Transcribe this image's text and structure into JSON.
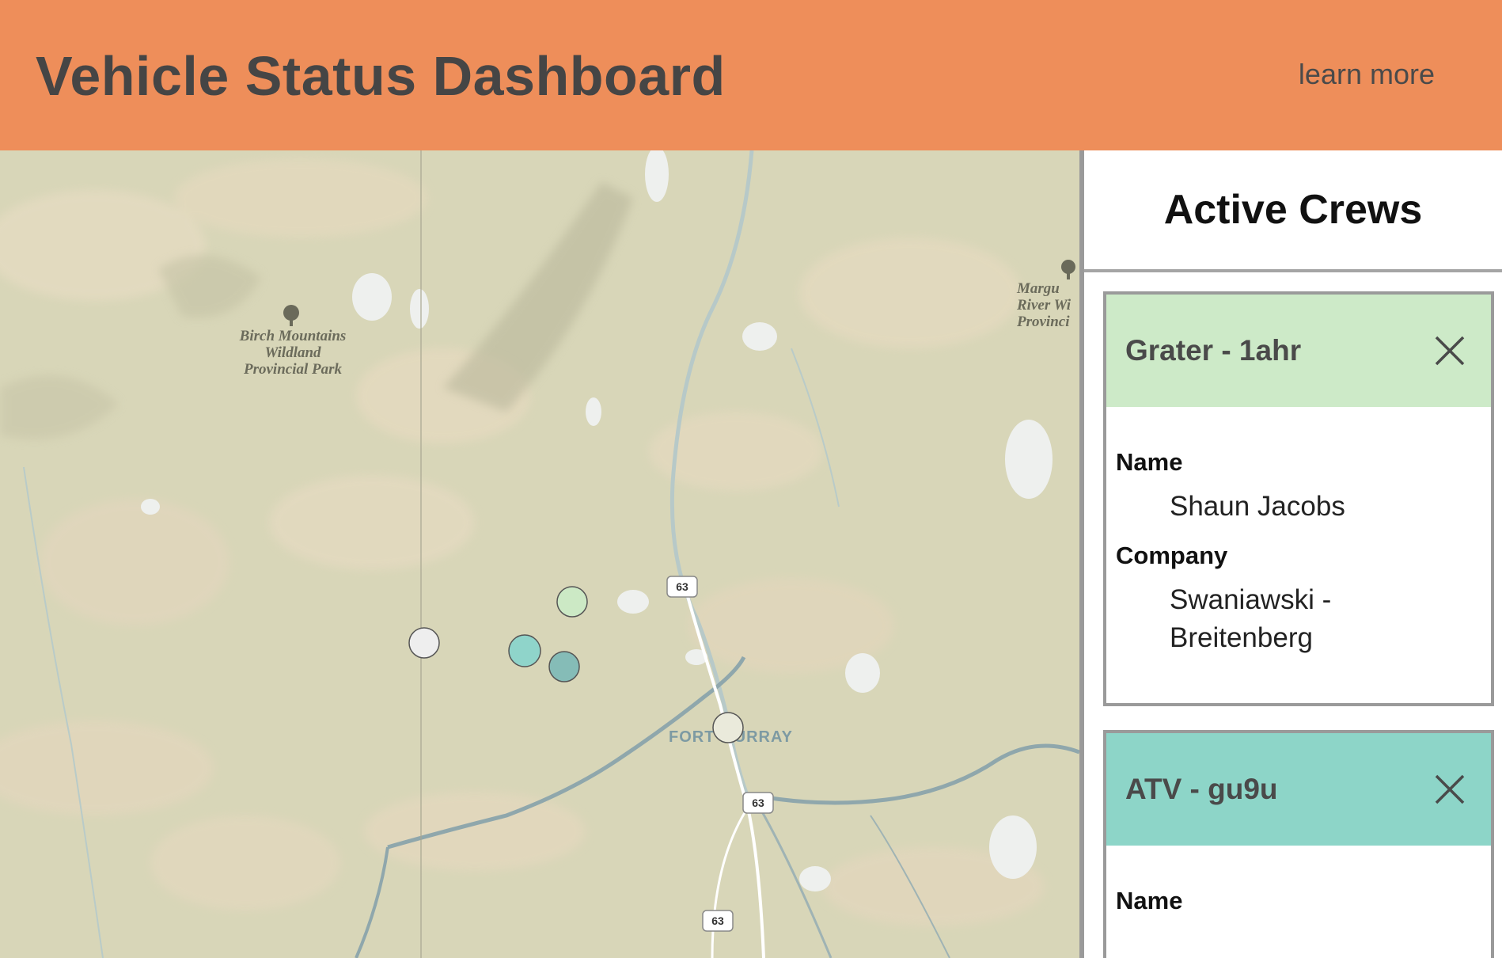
{
  "header": {
    "title": "Vehicle Status Dashboard",
    "learn_more": "learn more",
    "background": "#ee8e5a"
  },
  "map": {
    "labels": {
      "birch_park": [
        "Birch Mountains",
        "Wildland",
        "Provincial Park"
      ],
      "marg_park": [
        "Margu",
        "River Wi",
        "Provinci"
      ],
      "city": "FORT MURRAY"
    },
    "highway_shields": [
      "63",
      "63",
      "63"
    ],
    "markers": [
      {
        "color": "#cce9c5",
        "description": "light-green"
      },
      {
        "color": "#eeeeee",
        "description": "light-gray"
      },
      {
        "color": "#8fd4ca",
        "description": "teal"
      },
      {
        "color": "#85bcb7",
        "description": "dark-teal"
      },
      {
        "color": "#eaeadb",
        "description": "off-white"
      }
    ]
  },
  "sidebar": {
    "title": "Active Crews",
    "crews": [
      {
        "label": "Grater - 1ahr",
        "color": "#cdeac8",
        "name_label": "Name",
        "name": "Shaun Jacobs",
        "company_label": "Company",
        "company": "Swaniawski - Breitenberg"
      },
      {
        "label": "ATV - gu9u",
        "color": "#8dd5c8",
        "name_label": "Name"
      }
    ]
  }
}
